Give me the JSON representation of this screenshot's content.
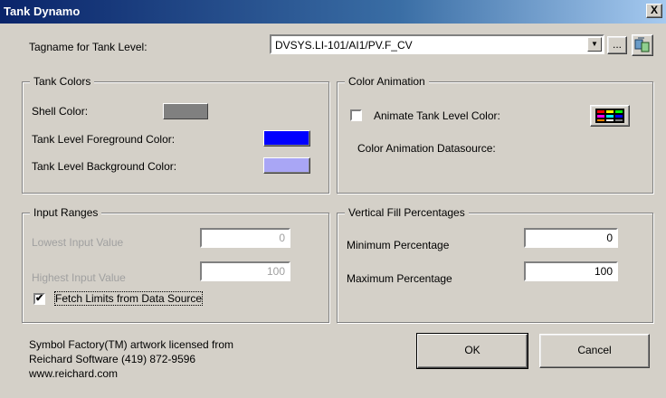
{
  "window": {
    "title": "Tank Dynamo",
    "close_glyph": "X"
  },
  "tagname": {
    "label": "Tagname for Tank Level:",
    "value": "DVSYS.LI-101/AI1/PV.F_CV",
    "browse_label": "..."
  },
  "tank_colors": {
    "title": "Tank Colors",
    "shell_label": "Shell Color:",
    "shell_color": "#808080",
    "fg_label": "Tank Level Foreground Color:",
    "fg_color": "#0000ff",
    "bg_label": "Tank Level Background Color:",
    "bg_color": "#a9a6f5"
  },
  "color_animation": {
    "title": "Color Animation",
    "animate_label": "Animate Tank Level Color:",
    "animate_checked": false,
    "datasource_label": "Color Animation Datasource:"
  },
  "input_ranges": {
    "title": "Input Ranges",
    "lowest_label": "Lowest Input Value",
    "lowest_value": "0",
    "highest_label": "Highest Input Value",
    "highest_value": "100",
    "fetch_label": "Fetch Limits from Data Source",
    "fetch_checked": true,
    "check_glyph": "✔"
  },
  "vertical_fill": {
    "title": "Vertical Fill Percentages",
    "min_label": "Minimum Percentage",
    "min_value": "0",
    "max_label": "Maximum Percentage",
    "max_value": "100"
  },
  "credits": {
    "line1": "Symbol Factory(TM) artwork licensed from",
    "line2": "Reichard Software (419) 872-9596",
    "line3": "www.reichard.com"
  },
  "buttons": {
    "ok": "OK",
    "cancel": "Cancel"
  }
}
